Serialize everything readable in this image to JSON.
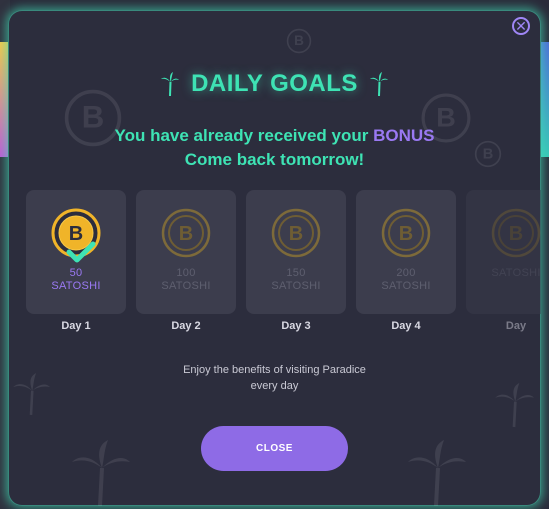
{
  "modal": {
    "title": "DAILY GOALS",
    "message_prefix": "You have already received your ",
    "message_bonus": "BONUS",
    "message_line2": "Come back tomorrow!",
    "enjoy_line1": "Enjoy the benefits of visiting Paradice",
    "enjoy_line2": "every day",
    "close_button": "CLOSE",
    "close_icon": "✕"
  },
  "days": [
    {
      "amount": "50",
      "unit": "SATOSHI",
      "label": "Day 1",
      "claimed": true
    },
    {
      "amount": "100",
      "unit": "SATOSHI",
      "label": "Day 2",
      "claimed": false
    },
    {
      "amount": "150",
      "unit": "SATOSHI",
      "label": "Day 3",
      "claimed": false
    },
    {
      "amount": "200",
      "unit": "SATOSHI",
      "label": "Day 4",
      "claimed": false
    },
    {
      "amount": "",
      "unit": "SATOSHI",
      "label": "Day",
      "claimed": false
    }
  ],
  "colors": {
    "accent_green": "#3ee3b4",
    "accent_purple": "#9a79f3",
    "coin_gold": "#f0b429",
    "card_bg": "#3c3d4d"
  }
}
